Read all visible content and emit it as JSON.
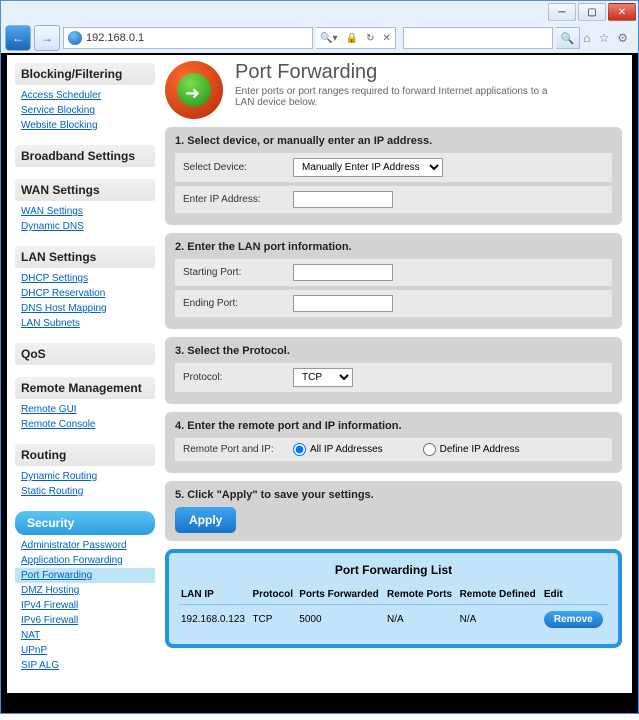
{
  "browser": {
    "url": "192.168.0.1"
  },
  "sidebar": {
    "sections": [
      {
        "title": "Blocking/Filtering",
        "links": [
          "Access Scheduler",
          "Service Blocking",
          "Website Blocking"
        ]
      },
      {
        "title": "Broadband Settings",
        "links": []
      },
      {
        "title": "WAN Settings",
        "links": [
          "WAN Settings",
          "Dynamic DNS"
        ]
      },
      {
        "title": "LAN Settings",
        "links": [
          "DHCP Settings",
          "DHCP Reservation",
          "DNS Host Mapping",
          "LAN Subnets"
        ]
      },
      {
        "title": "QoS",
        "links": []
      },
      {
        "title": "Remote Management",
        "links": [
          "Remote GUI",
          "Remote Console"
        ]
      },
      {
        "title": "Routing",
        "links": [
          "Dynamic Routing",
          "Static Routing"
        ]
      },
      {
        "title": "Security",
        "active": true,
        "links": [
          "Administrator Password",
          "Application Forwarding",
          "Port Forwarding",
          "DMZ Hosting",
          "IPv4 Firewall",
          "IPv6 Firewall",
          "NAT",
          "UPnP",
          "SIP ALG"
        ],
        "activeLink": "Port Forwarding"
      }
    ]
  },
  "page": {
    "title": "Port Forwarding",
    "subtitle": "Enter ports or port ranges required to forward Internet applications to a LAN device below."
  },
  "step1": {
    "title": "1. Select device, or manually enter an IP address.",
    "selectDeviceLabel": "Select Device:",
    "selectDeviceValue": "Manually Enter IP Address",
    "enterIpLabel": "Enter IP Address:",
    "enterIpValue": ""
  },
  "step2": {
    "title": "2. Enter the LAN port information.",
    "startLabel": "Starting Port:",
    "startValue": "",
    "endLabel": "Ending Port:",
    "endValue": ""
  },
  "step3": {
    "title": "3. Select the Protocol.",
    "protocolLabel": "Protocol:",
    "protocolValue": "TCP"
  },
  "step4": {
    "title": "4. Enter the remote port and IP information.",
    "remoteLabel": "Remote Port and IP:",
    "opt1": "All IP Addresses",
    "opt2": "Define IP Address"
  },
  "step5": {
    "title": "5. Click \"Apply\" to save your settings.",
    "applyLabel": "Apply"
  },
  "list": {
    "title": "Port Forwarding List",
    "headers": {
      "lanip": "LAN IP",
      "protocol": "Protocol",
      "ports": "Ports Forwarded",
      "remotePorts": "Remote Ports",
      "remoteDef": "Remote Defined",
      "edit": "Edit"
    },
    "row": {
      "lanip": "192.168.0.123",
      "protocol": "TCP",
      "ports": "5000",
      "remotePorts": "N/A",
      "remoteDef": "N/A"
    },
    "removeLabel": "Remove"
  }
}
